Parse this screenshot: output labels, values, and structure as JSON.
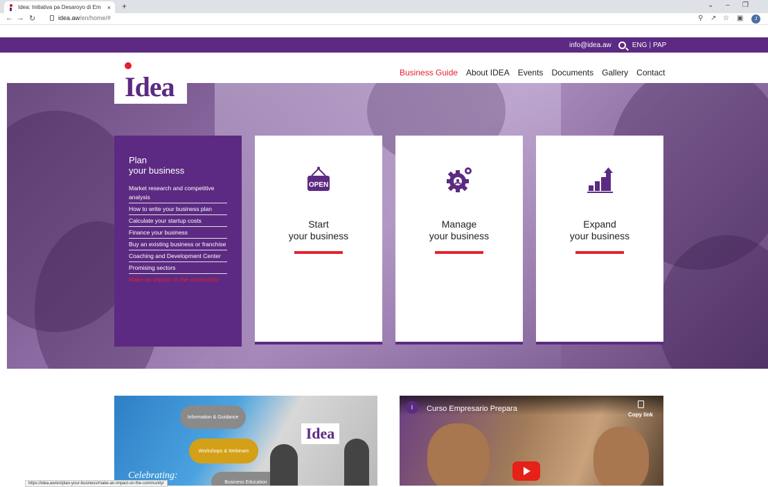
{
  "browser": {
    "tab_title": "Idea: Initiativa pa Desaroyo di Em",
    "tab_close": "×",
    "new_tab": "+",
    "url_host": "idea.aw",
    "url_path": "/en/home/#",
    "status_url": "https://idea.aw/en/plan-your-business/make-an-impact-on-the-community/"
  },
  "topbar": {
    "email": "info@idea.aw",
    "lang_en": "ENG",
    "lang_sep": "|",
    "lang_pap": "PAP"
  },
  "logo": {
    "text": "Idea"
  },
  "nav": {
    "items": [
      {
        "label": "Business Guide",
        "active": true
      },
      {
        "label": "About IDEA"
      },
      {
        "label": "Events"
      },
      {
        "label": "Documents"
      },
      {
        "label": "Gallery"
      },
      {
        "label": "Contact"
      }
    ]
  },
  "plan": {
    "title_line1": "Plan",
    "title_line2": "your business",
    "items": [
      "Market research and competitive analysis",
      "How to write your business plan",
      "Calculate your startup costs",
      "Finance your business",
      "Buy an existing business or franchise",
      "Coaching and Development Center",
      "Promising sectors",
      "Make an impact on the community"
    ]
  },
  "cards": [
    {
      "line1": "Start",
      "line2": "your business",
      "icon": "open-sign-icon"
    },
    {
      "line1": "Manage",
      "line2": "your business",
      "icon": "gear-icon"
    },
    {
      "line1": "Expand",
      "line2": "your business",
      "icon": "growth-chart-icon"
    }
  ],
  "promo": {
    "pill1": "Information & Guidance",
    "pill2": "Workshops & Webinars",
    "pill3": "Business Education",
    "celebrating": "Celebrating:",
    "logo": "Idea"
  },
  "video": {
    "avatar": "I",
    "title": "Curso Empresario Prepara",
    "copy_label": "Copy link"
  },
  "colors": {
    "brand_purple": "#5c2a82",
    "accent_red": "#e5202e"
  }
}
